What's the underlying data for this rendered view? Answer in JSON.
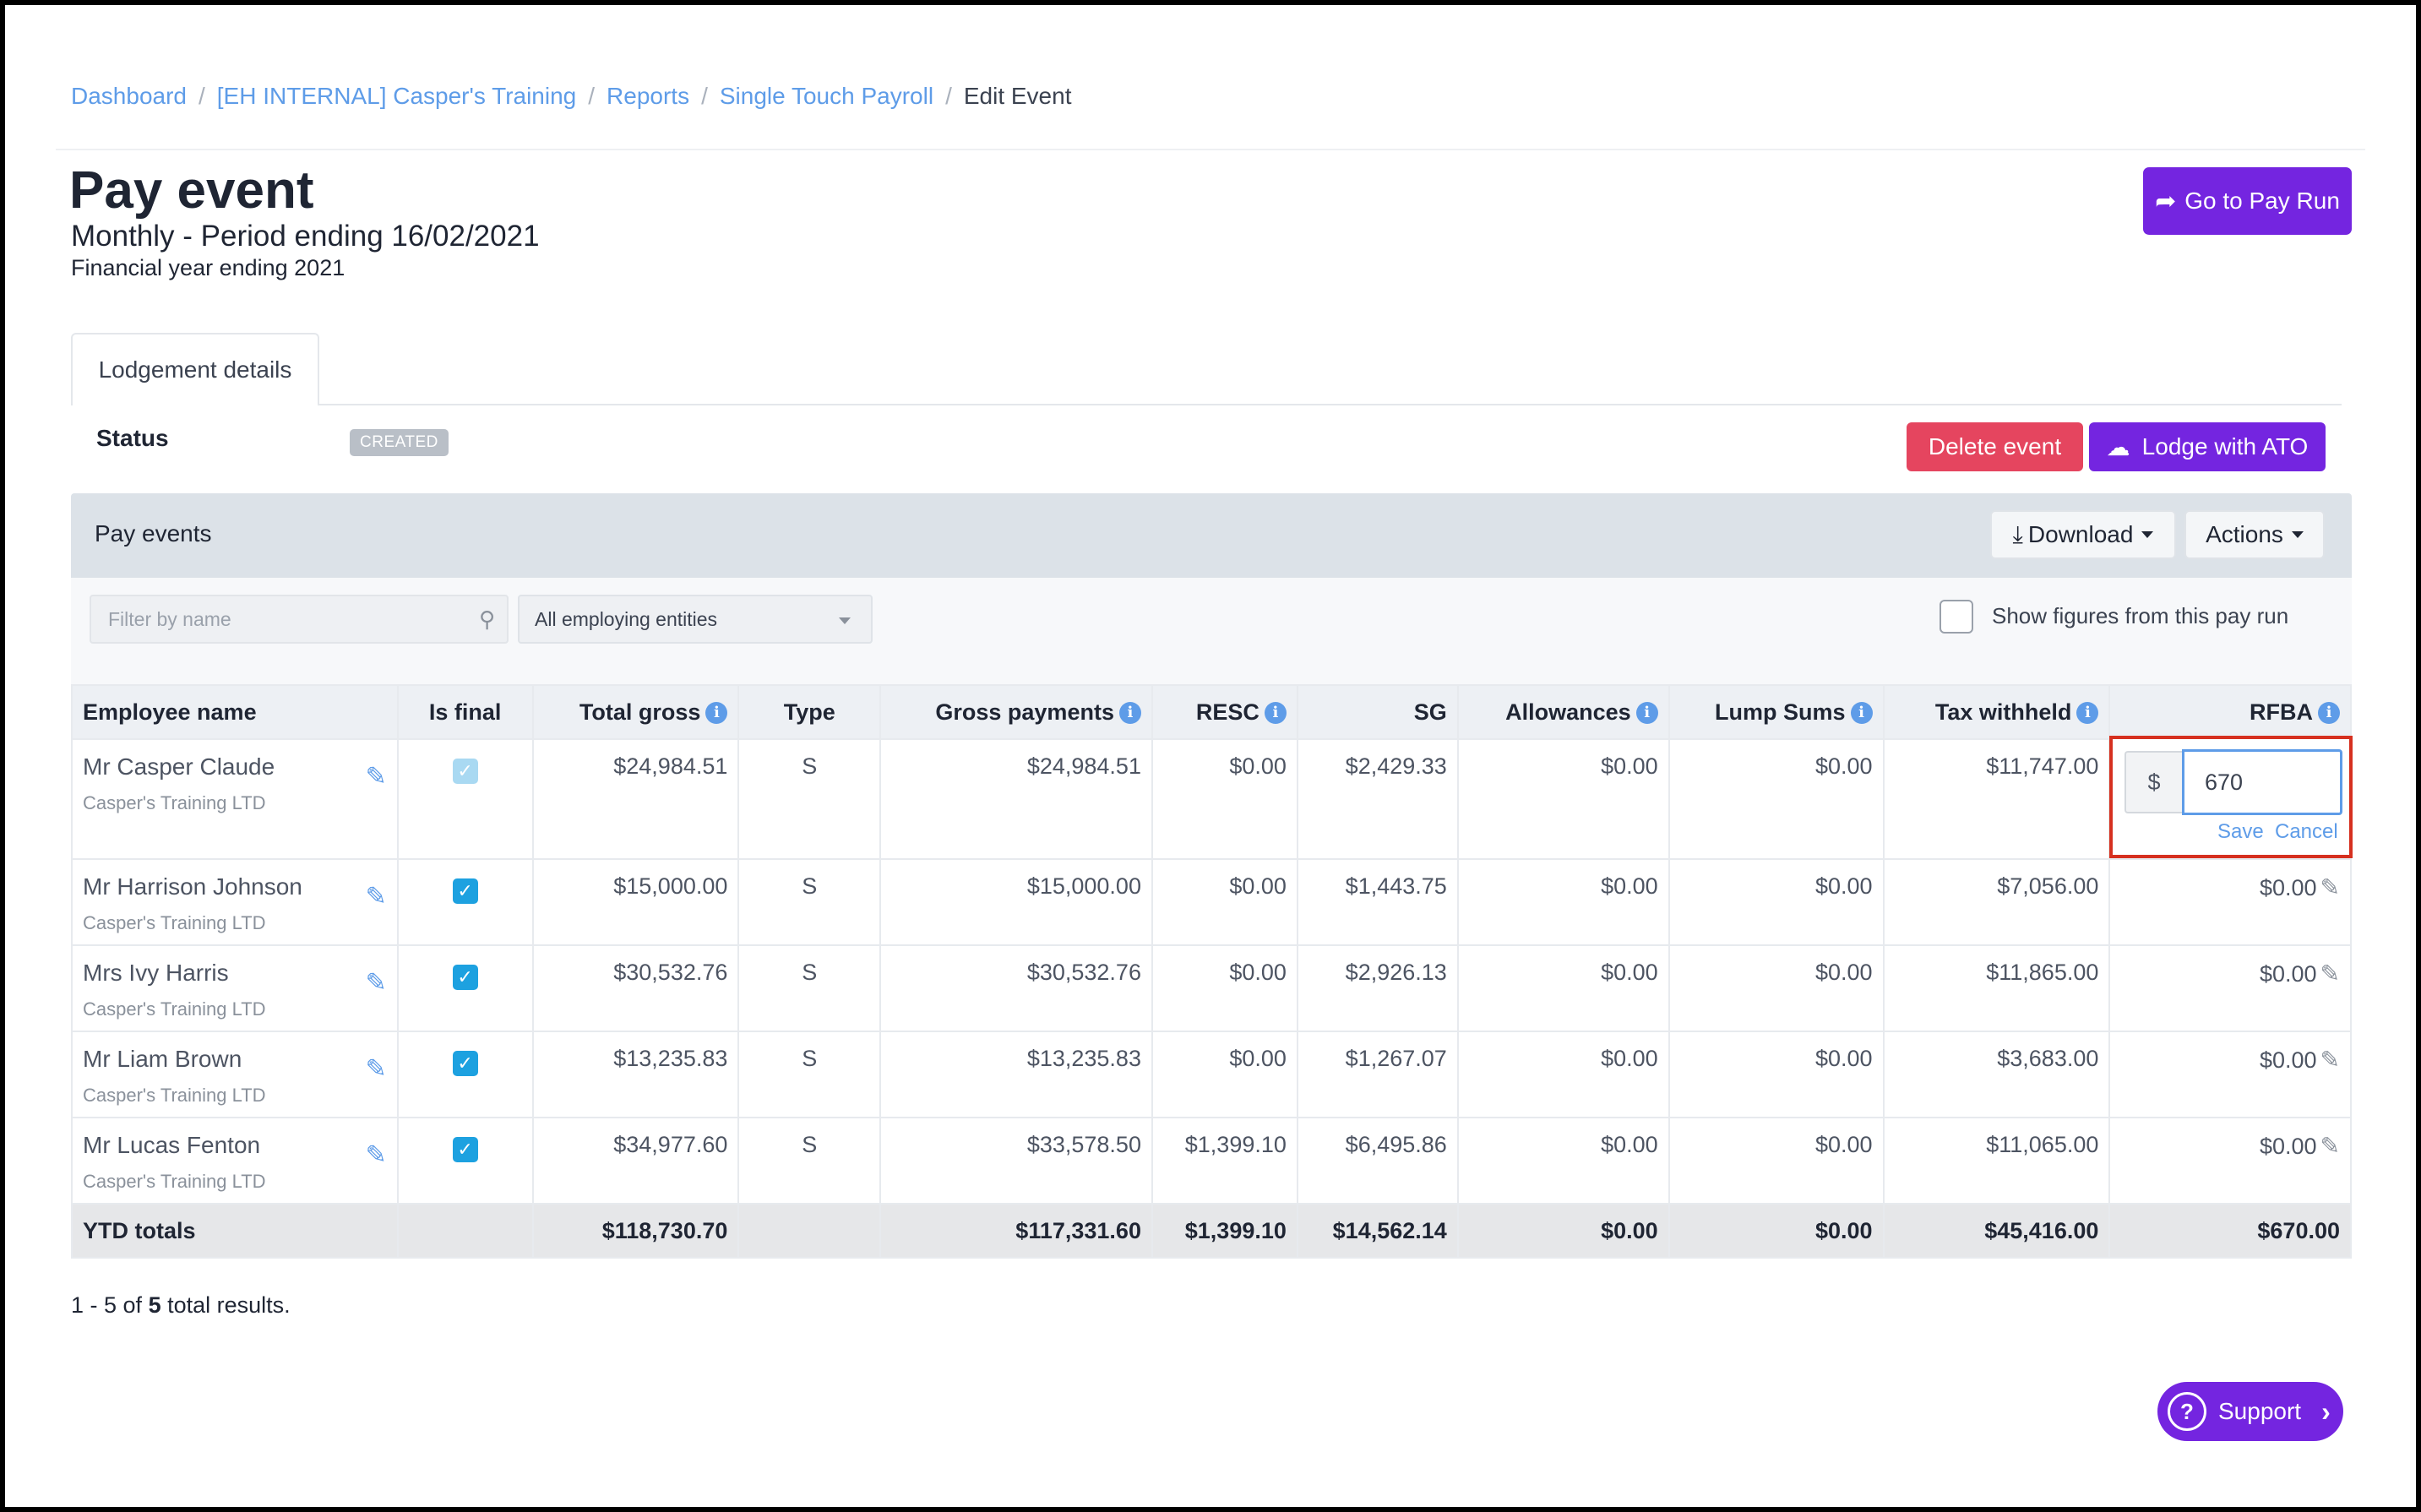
{
  "breadcrumb": {
    "items": [
      "Dashboard",
      "[EH INTERNAL] Casper's Training",
      "Reports",
      "Single Touch Payroll"
    ],
    "current": "Edit Event",
    "separator": "/"
  },
  "header": {
    "title": "Pay event",
    "subtitle": "Monthly - Period ending 16/02/2021",
    "financial_year": "Financial year ending 2021",
    "go_to_pay_run": "Go to Pay Run"
  },
  "tabs": {
    "lodgement": "Lodgement details"
  },
  "status": {
    "label": "Status",
    "badge": "CREATED"
  },
  "actions": {
    "delete": "Delete event",
    "lodge": "Lodge with ATO"
  },
  "panel": {
    "title": "Pay events",
    "download": "Download",
    "actions": "Actions",
    "filter_placeholder": "Filter by name",
    "entity_select": "All employing entities",
    "show_figures": "Show figures from this pay run"
  },
  "table": {
    "headers": [
      "Employee name",
      "Is final",
      "Total gross",
      "Type",
      "Gross payments",
      "RESC",
      "SG",
      "Allowances",
      "Lump Sums",
      "Tax withheld",
      "RFBA"
    ],
    "rows": [
      {
        "name": "Mr Casper Claude",
        "company": "Casper's Training LTD",
        "is_final": true,
        "total_gross": "$24,984.51",
        "type": "S",
        "gross_payments": "$24,984.51",
        "resc": "$0.00",
        "sg": "$2,429.33",
        "allowances": "$0.00",
        "lump_sums": "$0.00",
        "tax_withheld": "$11,747.00",
        "rfba": ""
      },
      {
        "name": "Mr Harrison Johnson",
        "company": "Casper's Training LTD",
        "is_final": true,
        "total_gross": "$15,000.00",
        "type": "S",
        "gross_payments": "$15,000.00",
        "resc": "$0.00",
        "sg": "$1,443.75",
        "allowances": "$0.00",
        "lump_sums": "$0.00",
        "tax_withheld": "$7,056.00",
        "rfba": "$0.00"
      },
      {
        "name": "Mrs Ivy Harris",
        "company": "Casper's Training LTD",
        "is_final": true,
        "total_gross": "$30,532.76",
        "type": "S",
        "gross_payments": "$30,532.76",
        "resc": "$0.00",
        "sg": "$2,926.13",
        "allowances": "$0.00",
        "lump_sums": "$0.00",
        "tax_withheld": "$11,865.00",
        "rfba": "$0.00"
      },
      {
        "name": "Mr Liam Brown",
        "company": "Casper's Training LTD",
        "is_final": true,
        "total_gross": "$13,235.83",
        "type": "S",
        "gross_payments": "$13,235.83",
        "resc": "$0.00",
        "sg": "$1,267.07",
        "allowances": "$0.00",
        "lump_sums": "$0.00",
        "tax_withheld": "$3,683.00",
        "rfba": "$0.00"
      },
      {
        "name": "Mr Lucas Fenton",
        "company": "Casper's Training LTD",
        "is_final": true,
        "total_gross": "$34,977.60",
        "type": "S",
        "gross_payments": "$33,578.50",
        "resc": "$1,399.10",
        "sg": "$6,495.86",
        "allowances": "$0.00",
        "lump_sums": "$0.00",
        "tax_withheld": "$11,065.00",
        "rfba": "$0.00"
      }
    ],
    "totals": {
      "label": "YTD totals",
      "total_gross": "$118,730.70",
      "gross_payments": "$117,331.60",
      "resc": "$1,399.10",
      "sg": "$14,562.14",
      "allowances": "$0.00",
      "lump_sums": "$0.00",
      "tax_withheld": "$45,416.00",
      "rfba": "$670.00"
    }
  },
  "rfba_edit": {
    "prefix": "$",
    "value": "670",
    "save": "Save",
    "cancel": "Cancel"
  },
  "pagination": {
    "range": "1 - 5 of",
    "total": "5",
    "suffix": "total results."
  },
  "support": {
    "label": "Support"
  },
  "colors": {
    "primary": "#7425e0",
    "danger": "#e5455f",
    "link": "#5e9ce8",
    "highlight": "#d6301f"
  },
  "icons": [
    "share-arrow-icon",
    "cloud-upload-icon",
    "download-icon",
    "search-icon",
    "info-icon",
    "pencil-icon",
    "checkbox-icon",
    "question-circle-icon",
    "chevron-right-icon"
  ]
}
